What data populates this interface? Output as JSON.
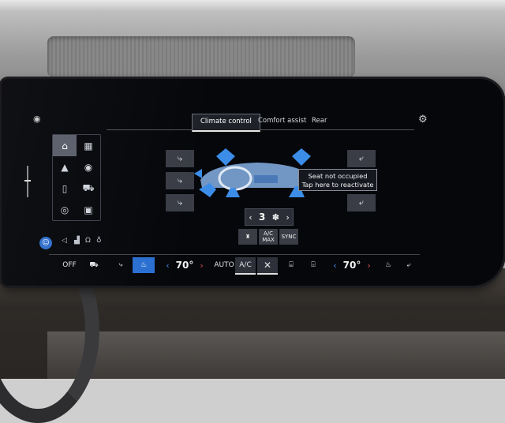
{
  "tabs": [
    {
      "label": "Climate control",
      "active": true
    },
    {
      "label": "Comfort assist",
      "active": false
    },
    {
      "label": "Rear",
      "active": false
    }
  ],
  "popup": {
    "line1": "Seat not occupied",
    "line2": "Tap here to reactivate"
  },
  "fan": {
    "level": "3",
    "left": "‹",
    "right": "›",
    "icon": "✽"
  },
  "mid_buttons": {
    "seat": "♜",
    "ac_max": "A/C MAX",
    "sync": "SYNC"
  },
  "bottom_bar": {
    "off": "OFF",
    "left_temp": "70°",
    "auto": "AUTO",
    "ac": "A/C",
    "close": "✕",
    "right_temp": "70°",
    "chev_left": "‹",
    "chev_right": "›"
  },
  "colors": {
    "accent": "#2a6fd1",
    "airflow": "#3b8de8",
    "warm": "#e05050"
  },
  "icons": {
    "bell": "🔔",
    "gear": "⚙",
    "home": "⌂",
    "apps": "▦",
    "nav": "▲",
    "radio": "((•))",
    "phone": "▯",
    "car": "⛟",
    "media": "⏏",
    "bag": "⌂"
  }
}
